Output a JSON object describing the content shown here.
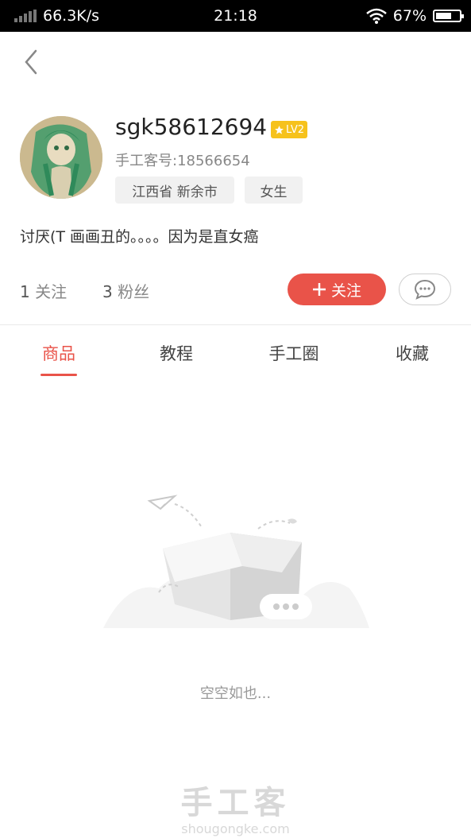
{
  "status_bar": {
    "network_speed": "66.3K/s",
    "time": "21:18",
    "battery": "67%",
    "battery_level": 0.67
  },
  "profile": {
    "username": "sgk58612694",
    "level_badge": "LV2",
    "user_id": "手工客号:18566654",
    "region": "江西省 新余市",
    "gender": "女生",
    "bio": "讨厌(T 画画丑的。。。。因为是直女癌"
  },
  "stats": {
    "following_count": "1",
    "following_label": "关注",
    "fans_count": "3",
    "fans_label": "粉丝"
  },
  "actions": {
    "follow_label": "关注"
  },
  "tabs": [
    {
      "label": "商品",
      "active": true
    },
    {
      "label": "教程",
      "active": false
    },
    {
      "label": "手工圈",
      "active": false
    },
    {
      "label": "收藏",
      "active": false
    }
  ],
  "empty_state": {
    "text": "空空如也..."
  },
  "watermark": {
    "title": "手工客",
    "url": "shougongke.com"
  },
  "colors": {
    "accent": "#e95349",
    "badge": "#f6c21c"
  }
}
